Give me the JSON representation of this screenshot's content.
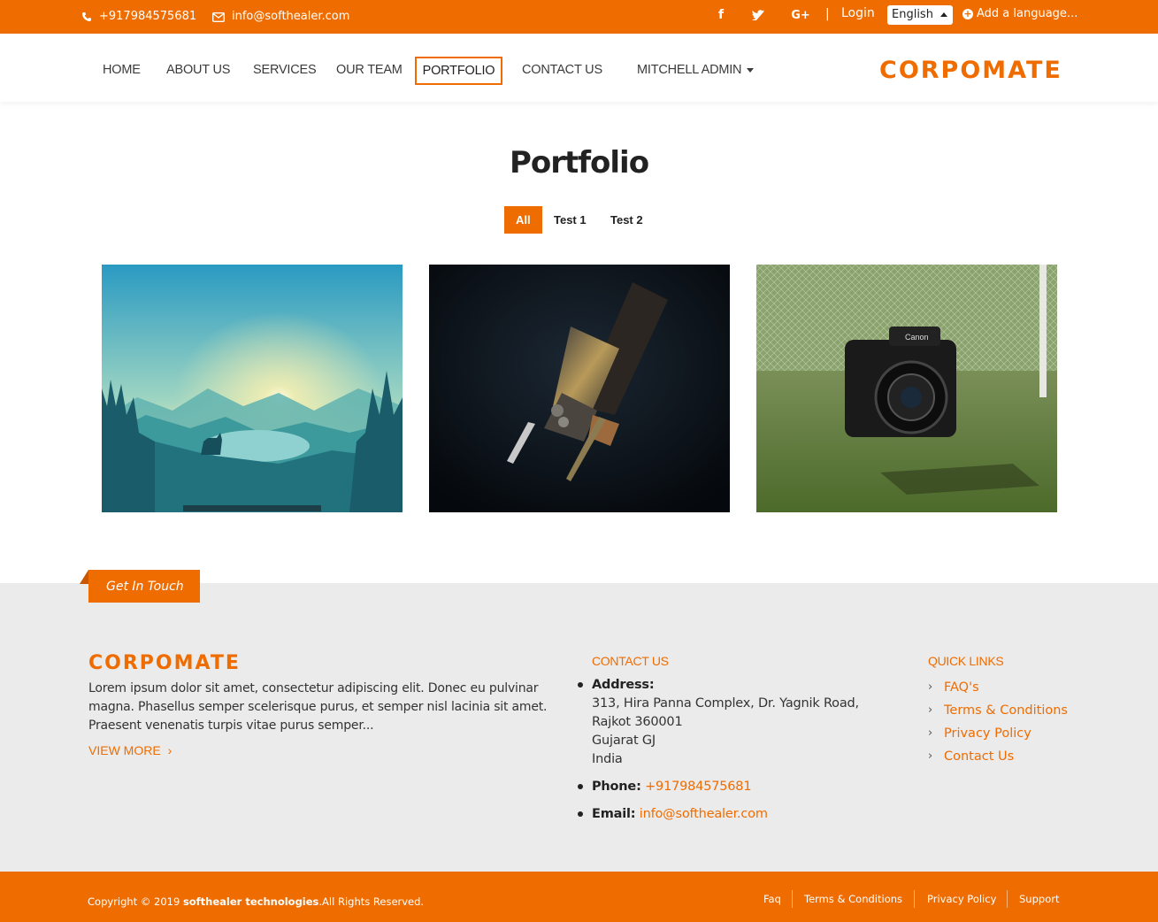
{
  "topbar": {
    "phone": "+917984575681",
    "email": "info@softhealer.com",
    "social_icons": [
      "facebook-icon",
      "twitter-icon",
      "google-plus-icon"
    ],
    "separator": "|",
    "login": "Login",
    "language": "English",
    "add_language": "Add a language..."
  },
  "nav": {
    "items": [
      {
        "label": "HOME"
      },
      {
        "label": "ABOUT US"
      },
      {
        "label": "SERVICES"
      },
      {
        "label": "OUR TEAM"
      },
      {
        "label": "PORTFOLIO",
        "active": true
      },
      {
        "label": "CONTACT US"
      },
      {
        "label": "MITCHELL ADMIN"
      }
    ],
    "logo": "CORPOMATE"
  },
  "main": {
    "title": "Portfolio",
    "filters": [
      "All",
      "Test 1",
      "Test 2"
    ]
  },
  "footer": {
    "tab_label": "Get In Touch",
    "logo": "CORPOMATE",
    "about_text": "Lorem ipsum dolor sit amet, consectetur adipiscing elit. Donec eu pulvinar magna. Phasellus semper scelerisque purus, et semper nisl lacinia sit amet. Praesent venenatis turpis vitae purus semper...",
    "view_more": "VIEW MORE",
    "contact": {
      "title": "CONTACT US",
      "address_label": "Address:",
      "address_lines": [
        "313, Hira Panna Complex, Dr. Yagnik Road,",
        "Rajkot 360001",
        "Gujarat GJ",
        "India"
      ],
      "phone_label": "Phone:",
      "phone": "+917984575681",
      "email_label": "Email:",
      "email": "info@softhealer.com"
    },
    "quick_links": {
      "title": "QUICK LINKS",
      "items": [
        "FAQ's",
        "Terms & Conditions",
        "Privacy Policy",
        "Contact Us"
      ]
    }
  },
  "bottom": {
    "copyright_prefix": "Copyright © 2019",
    "company": "softhealer technologies",
    "copyright_suffix": ".All Rights Reserved.",
    "links": [
      "Faq",
      "Terms & Conditions",
      "Privacy Policy",
      "Support"
    ]
  },
  "colors": {
    "accent": "#ef6c00",
    "footer_bg": "#ebebeb"
  }
}
